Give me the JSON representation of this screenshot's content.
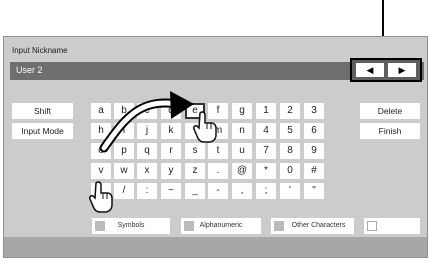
{
  "title": "Input Nickname",
  "input": {
    "value": "User 2"
  },
  "cursor": {
    "left": "◀",
    "right": "▶"
  },
  "side_keys": {
    "shift": "Shift",
    "input_mode": "Input Mode",
    "delete": "Delete",
    "finish": "Finish"
  },
  "keys": [
    [
      "a",
      "b",
      "c",
      "d",
      "e",
      "f",
      "g",
      "1",
      "2",
      "3"
    ],
    [
      "h",
      "i",
      "j",
      "k",
      "l",
      "m",
      "n",
      "4",
      "5",
      "6"
    ],
    [
      "o",
      "p",
      "q",
      "r",
      "s",
      "t",
      "u",
      "7",
      "8",
      "9"
    ],
    [
      "v",
      "w",
      "x",
      "y",
      "z",
      ".",
      "@",
      "*",
      "0",
      "#"
    ],
    [
      "",
      "/",
      ":",
      "~",
      "_",
      "-",
      ",",
      ";",
      "'",
      "\""
    ]
  ],
  "modes": {
    "symbols": "Symbols",
    "alphanumeric": "Alphanumeric",
    "other": "Other Characters"
  },
  "colors": {
    "screen_bg": "#cccccc",
    "input_bg": "#6e6e6e",
    "bottom_bar": "#a7a7a7"
  }
}
